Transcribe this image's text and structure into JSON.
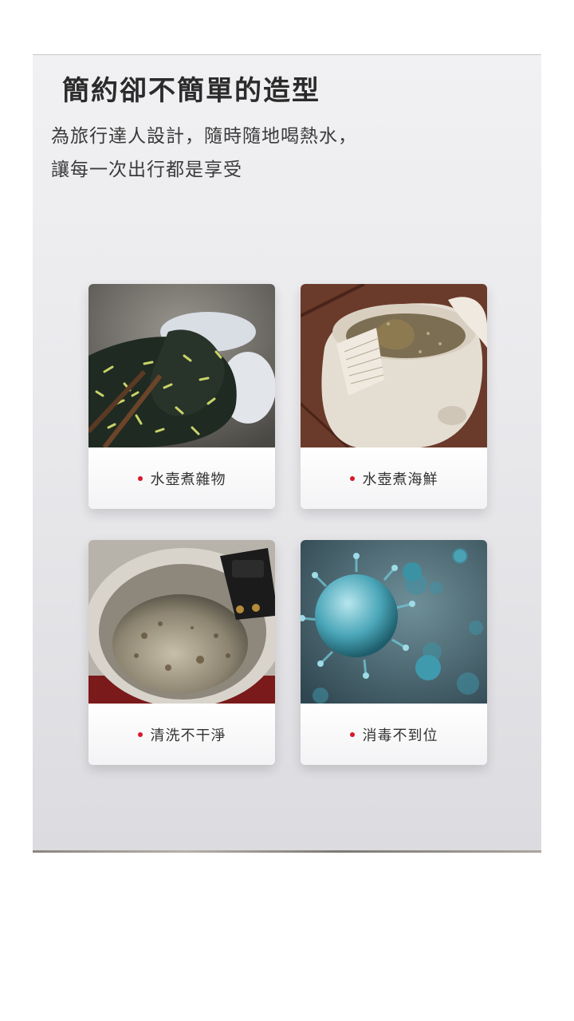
{
  "header": {
    "title": "簡約卻不簡單的造型",
    "subtitle_line1": "為旅行達人設計，隨時隨地喝熱水，",
    "subtitle_line2": "讓每一次出行都是享受"
  },
  "cards": [
    {
      "label": "水壺煮雜物",
      "image": "kettle-debris-photo"
    },
    {
      "label": "水壺煮海鮮",
      "image": "kettle-seafood-photo"
    },
    {
      "label": "清洗不干淨",
      "image": "dirty-kettle-photo"
    },
    {
      "label": "消毒不到位",
      "image": "bacteria-photo"
    }
  ],
  "colors": {
    "accent_dot": "#d7182a",
    "title_text": "#2b2b2b",
    "panel_bg": "#ececef"
  }
}
